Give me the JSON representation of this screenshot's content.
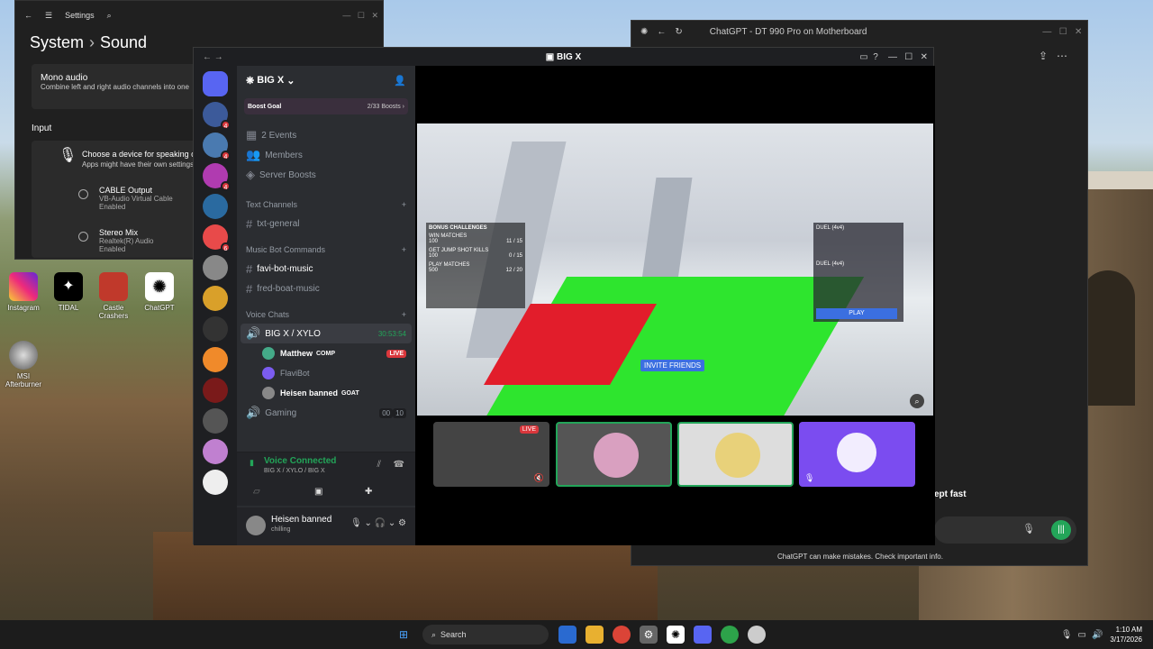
{
  "settings": {
    "app_title": "Settings",
    "breadcrumb_parent": "System",
    "breadcrumb_sep": "›",
    "page_title": "Sound",
    "mono_title": "Mono audio",
    "mono_desc": "Combine left and right audio channels into one",
    "input_heading": "Input",
    "choose_title": "Choose a device for speaking or re",
    "choose_desc": "Apps might have their own settings",
    "devices": [
      {
        "name": "CABLE Output",
        "sub": "VB-Audio Virtual Cable",
        "state": "Enabled"
      },
      {
        "name": "Stereo Mix",
        "sub": "Realtek(R) Audio",
        "state": "Enabled"
      }
    ]
  },
  "desktop": {
    "icons": [
      "Instagram",
      "TIDAL",
      "Castle Crashers",
      "ChatGPT",
      "MSI Afterburner"
    ]
  },
  "discord": {
    "window_title": "BIG X",
    "server_name": "BIG X",
    "boost_goal": "Boost Goal",
    "boost_count": "2/33 Boosts",
    "top_items": [
      "2 Events",
      "Members",
      "Server Boosts"
    ],
    "cat_text": "Text Channels",
    "text_channels": [
      "txt-general"
    ],
    "cat_music": "Music Bot Commands",
    "music_channels": [
      "favi-bot-music",
      "fred-boat-music"
    ],
    "cat_voice": "Voice Chats",
    "voice_channel": "BIG X / XYLO",
    "voice_timer": "30:53:54",
    "voice_users": [
      {
        "name": "Matthew",
        "tag": "COMP",
        "live": "LIVE"
      },
      {
        "name": "FlaviBot",
        "tag": "",
        "live": ""
      },
      {
        "name": "Heisen banned",
        "tag": "GOAT",
        "live": ""
      }
    ],
    "gaming_channel": "Gaming",
    "gaming_counts": [
      "00",
      "10"
    ],
    "guild_badges": [
      "4",
      "4",
      "4",
      "6"
    ],
    "voice_connected": "Voice Connected",
    "voice_path": "BIG X / XYLO / BIG X",
    "user_name": "Heisen banned",
    "user_status": "chilling",
    "invite_friends": "INVITE FRIENDS",
    "tile_live": "LIVE",
    "game_play": "PLAY",
    "game_duel1": "DUEL (4v4)",
    "game_duel2": "DUEL (4v4)",
    "game_hud_title": "BONUS CHALLENGES",
    "game_challenges": [
      {
        "label": "WIN MATCHES",
        "value": "100",
        "progress": "11 / 15"
      },
      {
        "label": "GET JUMP SHOT KILLS",
        "value": "100",
        "progress": "0 / 15"
      },
      {
        "label": "PLAY MATCHES",
        "value": "500",
        "progress": "12 / 20"
      }
    ]
  },
  "chatgpt": {
    "window_title": "ChatGPT - DT 990 Pro on Motherboard",
    "partial_text": "ept fast",
    "disclaimer": "ChatGPT can make mistakes. Check important info."
  },
  "taskbar": {
    "search_placeholder": "Search",
    "time": "1:10 AM",
    "date": "3/17/2026"
  },
  "colors": {
    "discord_green": "#23a559",
    "discord_red": "#da373c",
    "blurple": "#5865f2"
  }
}
